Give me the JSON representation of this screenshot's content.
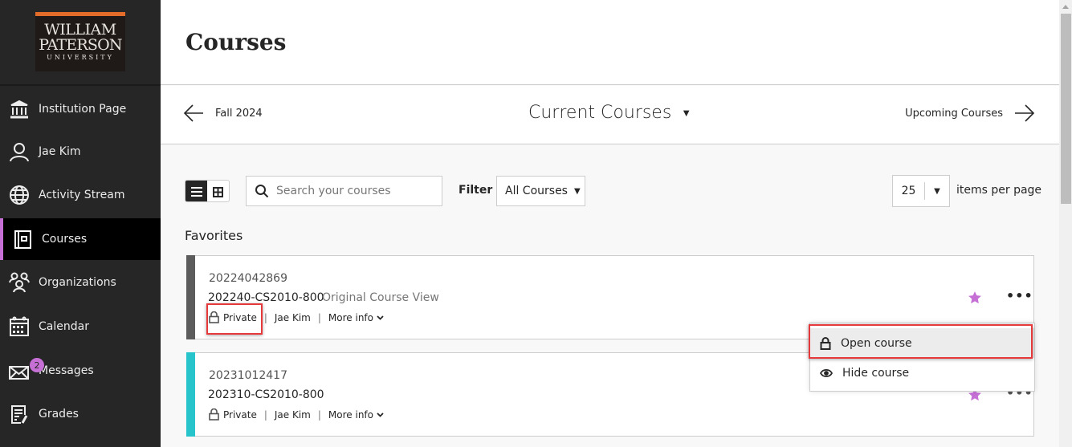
{
  "sidebar": {
    "logo": {
      "line1": "WILLIAM",
      "line2": "PATERSON",
      "line3": "UNIVERSITY"
    },
    "items": [
      {
        "label": "Institution Page",
        "icon": "institution-icon"
      },
      {
        "label": "Jae Kim",
        "icon": "user-icon"
      },
      {
        "label": "Activity Stream",
        "icon": "globe-icon"
      },
      {
        "label": "Courses",
        "icon": "courses-icon",
        "active": true
      },
      {
        "label": "Organizations",
        "icon": "organizations-icon"
      },
      {
        "label": "Calendar",
        "icon": "calendar-icon"
      },
      {
        "label": "Messages",
        "icon": "messages-icon",
        "badge": "2"
      },
      {
        "label": "Grades",
        "icon": "grades-icon"
      }
    ]
  },
  "header": {
    "title": "Courses"
  },
  "term_nav": {
    "prev_label": "Fall 2024",
    "current_label": "Current Courses",
    "next_label": "Upcoming Courses"
  },
  "toolbar": {
    "search_placeholder": "Search your courses",
    "search_value": "",
    "filter_label": "Filter",
    "filter_value": "All Courses",
    "per_page_value": "25",
    "per_page_label": "items per page"
  },
  "favorites": {
    "title": "Favorites",
    "courses": [
      {
        "id": "20224042869",
        "name": "202240-CS2010-800",
        "view": "Original Course View",
        "privacy": "Private",
        "instructor": "Jae Kim",
        "more": "More info",
        "stripe_color": "#5c5c5c",
        "favorited": true
      },
      {
        "id": "20231012417",
        "name": "202310-CS2010-800",
        "view": "",
        "privacy": "Private",
        "instructor": "Jae Kim",
        "more": "More info",
        "stripe_color": "#27c4cc",
        "favorited": true
      }
    ]
  },
  "context_menu": {
    "items": [
      {
        "label": "Open course",
        "icon": "lock-icon"
      },
      {
        "label": "Hide course",
        "icon": "eye-icon"
      }
    ]
  },
  "colors": {
    "accent": "#c670d6",
    "highlight": "#e5393b",
    "sidebar_bg": "#262626"
  }
}
